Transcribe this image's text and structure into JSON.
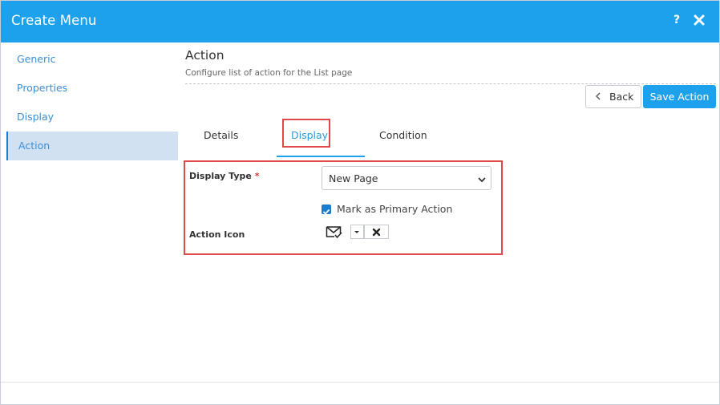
{
  "dialog": {
    "title": "Create Menu",
    "help_label": "?"
  },
  "sidebar": {
    "items": [
      {
        "label": "Generic"
      },
      {
        "label": "Properties"
      },
      {
        "label": "Display"
      },
      {
        "label": "Action",
        "active": true
      }
    ]
  },
  "section": {
    "title": "Action",
    "subtitle": "Configure list of action for the List page"
  },
  "toolbar": {
    "back_label": "Back",
    "back_icon": "chevron-left-icon",
    "save_label": "Save Action"
  },
  "tabs": [
    {
      "label": "Details"
    },
    {
      "label": "Display",
      "active": true
    },
    {
      "label": "Condition"
    }
  ],
  "form": {
    "display_type_label": "Display Type",
    "required_marker": "*",
    "display_type_value": "New Page",
    "primary_action_label": "Mark as Primary Action",
    "primary_action_checked": true,
    "action_icon_label": "Action Icon",
    "action_icon_name": "envelope-check-icon"
  },
  "colors": {
    "titlebar": "#1da1ec",
    "accent": "#1da1ec",
    "sidebar_active_bg": "#d2e1f1",
    "highlight_border": "#e04848",
    "required": "#e23b3b"
  }
}
